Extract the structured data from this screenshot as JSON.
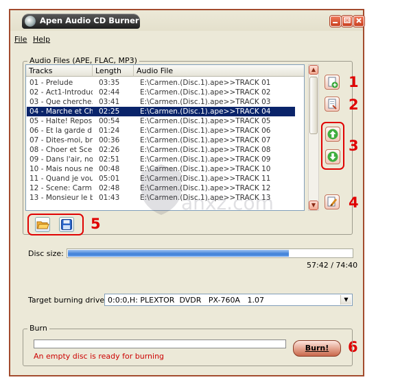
{
  "window": {
    "title": "Apen Audio CD Burner"
  },
  "title_buttons": [
    "minimize",
    "restore",
    "close"
  ],
  "menu": [
    {
      "label": "File"
    },
    {
      "label": "Help"
    }
  ],
  "audio_files": {
    "group_label": "Audio Files (APE, FLAC, MP3)",
    "columns": [
      "Tracks",
      "Length",
      "Audio File"
    ],
    "selected_index": 3,
    "rows": [
      {
        "track": "01 - Prelude",
        "length": "03:35",
        "file": "E:\\Carmen.(Disc.1).ape>>TRACK 01"
      },
      {
        "track": "02 - Act1-Introduc...",
        "length": "02:44",
        "file": "E:\\Carmen.(Disc.1).ape>>TRACK 02"
      },
      {
        "track": "03 - Que cherche...",
        "length": "03:41",
        "file": "E:\\Carmen.(Disc.1).ape>>TRACK 03"
      },
      {
        "track": "04 - Marche et Ch...",
        "length": "02:25",
        "file": "E:\\Carmen.(Disc.1).ape>>TRACK 04"
      },
      {
        "track": "05 - Halte! Repos...",
        "length": "00:54",
        "file": "E:\\Carmen.(Disc.1).ape>>TRACK 05"
      },
      {
        "track": "06 - Et la garde d...",
        "length": "01:24",
        "file": "E:\\Carmen.(Disc.1).ape>>TRACK 06"
      },
      {
        "track": "07 - Dites-moi, bri...",
        "length": "00:36",
        "file": "E:\\Carmen.(Disc.1).ape>>TRACK 07"
      },
      {
        "track": "08 - Choer et Sce...",
        "length": "02:26",
        "file": "E:\\Carmen.(Disc.1).ape>>TRACK 08"
      },
      {
        "track": "09 - Dans l'air, noi...",
        "length": "02:51",
        "file": "E:\\Carmen.(Disc.1).ape>>TRACK 09"
      },
      {
        "track": "10 - Mais nous ne...",
        "length": "00:48",
        "file": "E:\\Carmen.(Disc.1).ape>>TRACK 10"
      },
      {
        "track": "11 - Quand je vou...",
        "length": "05:01",
        "file": "E:\\Carmen.(Disc.1).ape>>TRACK 11"
      },
      {
        "track": "12 - Scene: Carm...",
        "length": "02:48",
        "file": "E:\\Carmen.(Disc.1).ape>>TRACK 12"
      },
      {
        "track": "13 - Monsieur le b...",
        "length": "01:43",
        "file": "E:\\Carmen.(Disc.1).ape>>TRACK 13"
      }
    ]
  },
  "side_buttons": [
    {
      "name": "add-files",
      "icon": "add-file-icon"
    },
    {
      "name": "remove-file",
      "icon": "remove-file-icon"
    },
    {
      "name": "move-up",
      "icon": "arrow-up-icon"
    },
    {
      "name": "move-down",
      "icon": "arrow-down-icon"
    },
    {
      "name": "clear-list",
      "icon": "clear-list-icon"
    }
  ],
  "list_buttons": [
    {
      "name": "open",
      "icon": "folder-open-icon"
    },
    {
      "name": "save",
      "icon": "floppy-save-icon"
    }
  ],
  "callouts": [
    "1",
    "2",
    "3",
    "4",
    "5",
    "6"
  ],
  "disc": {
    "label": "Disc size:",
    "used_fraction": 0.777,
    "time_used": "57:42",
    "time_sep": "/",
    "time_total": "74:40"
  },
  "driver": {
    "label": "Target burning driver:",
    "value": "0:0:0,H: PLEXTOR  DVDR   PX-760A   1.07"
  },
  "burn": {
    "group_label": "Burn",
    "status": "An empty disc is ready for burning",
    "button_label": "Burn!",
    "progress": 0
  },
  "watermark": {
    "text": "anxz.com"
  },
  "colors": {
    "window_border": "#a24a2c",
    "selection": "#0a246a",
    "callout": "#e00000",
    "status_text": "#cc0000",
    "disc_fill": "#3e7fd8"
  }
}
